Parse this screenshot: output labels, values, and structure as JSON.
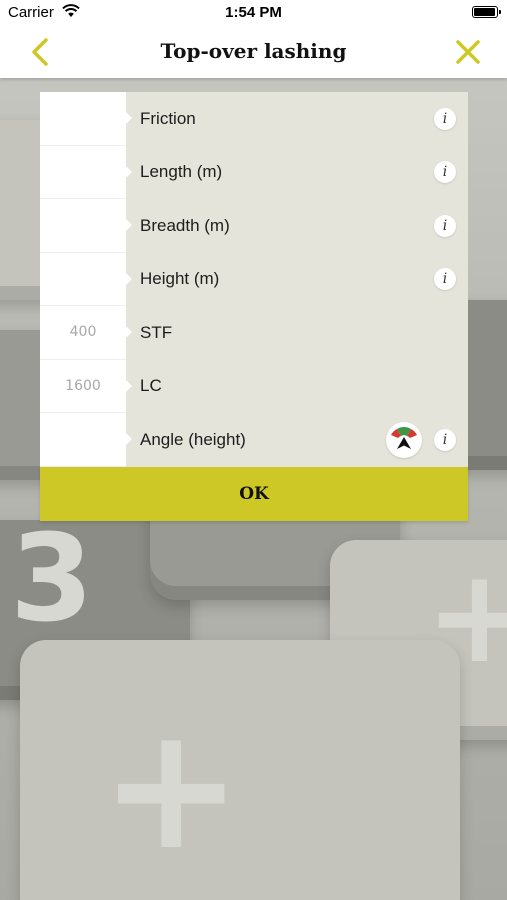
{
  "status_bar": {
    "carrier": "Carrier",
    "time": "1:54 PM",
    "battery_level": 0.95
  },
  "navbar": {
    "title": "Top-over lashing",
    "back_icon": "chevron-left-icon",
    "close_icon": "close-icon",
    "accent_color": "#cdc825"
  },
  "form": {
    "rows": [
      {
        "label": "Friction",
        "value": "",
        "info": "i"
      },
      {
        "label": "Length (m)",
        "value": "",
        "info": "i"
      },
      {
        "label": "Breadth (m)",
        "value": "",
        "info": "i"
      },
      {
        "label": "Height (m)",
        "value": "",
        "info": "i"
      },
      {
        "label": "STF",
        "value": "400"
      },
      {
        "label": "LC",
        "value": "1600"
      },
      {
        "label": "Angle (height)",
        "value": "",
        "info": "i",
        "icon": "angle-selector-icon"
      }
    ]
  },
  "ok_button": {
    "label": "OK"
  }
}
